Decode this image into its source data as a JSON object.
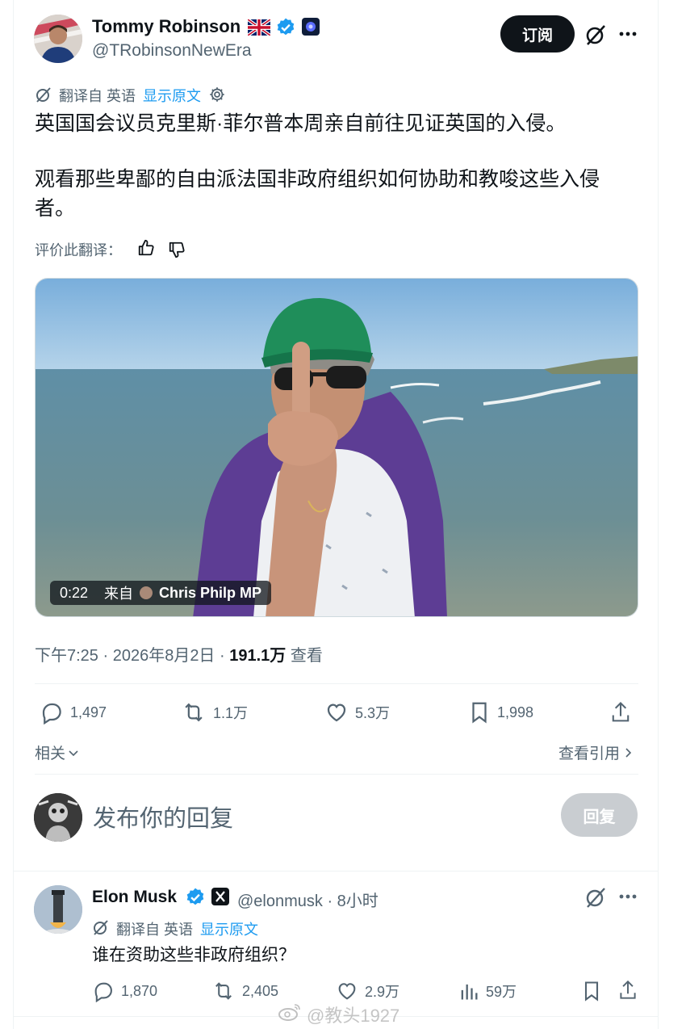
{
  "tweet": {
    "author_name": "Tommy Robinson",
    "author_handle": "@TRobinsonNewEra",
    "subscribe_label": "订阅",
    "translated_from": "翻译自 英语",
    "show_original": "显示原文",
    "text_p1": "英国国会议员克里斯·菲尔普本周亲自前往见证英国的入侵。",
    "text_p2": "观看那些卑鄙的自由派法国非政府组织如何协助和教唆这些入侵者。",
    "rate_translation": "评价此翻译：",
    "video_time": "0:22",
    "video_from_prefix": "来自",
    "video_from_name": "Chris Philp MP",
    "timestamp": "下午7:25 · 2026年8月2日 · ",
    "views_count": "191.1万",
    "views_label": " 查看",
    "stats": {
      "replies": "1,497",
      "retweets": "1.1万",
      "likes": "5.3万",
      "bookmarks": "1,998"
    },
    "related_label": "相关",
    "view_quotes_label": "查看引用"
  },
  "composer": {
    "placeholder": "发布你的回复",
    "reply_button": "回复"
  },
  "reply": {
    "author_name": "Elon Musk",
    "author_handle": "@elonmusk",
    "time": " · 8小时",
    "translated_from": "翻译自 英语",
    "show_original": "显示原文",
    "text": "谁在资助这些非政府组织？",
    "stats": {
      "replies": "1,870",
      "retweets": "2,405",
      "likes": "2.9万",
      "views": "59万"
    }
  },
  "watermark": "@教头1927",
  "colors": {
    "accent": "#1d9bf0",
    "muted": "#536471",
    "subscribe_bg": "#0f1419",
    "reply_button_bg": "#c9cdd1"
  }
}
